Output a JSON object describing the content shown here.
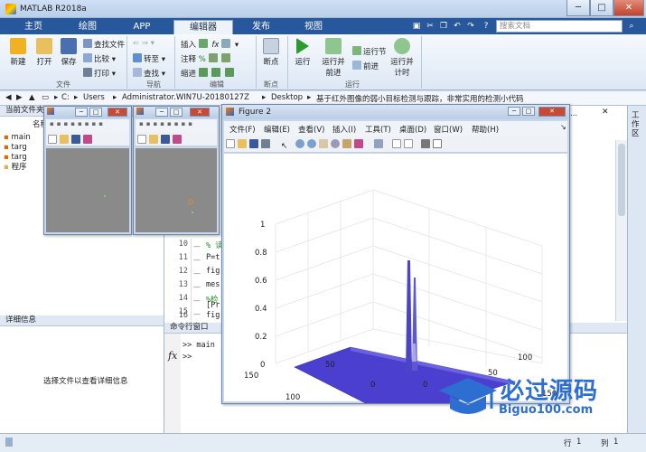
{
  "app": {
    "title": "MATLAB R2018a"
  },
  "window_controls": {
    "minimize": "─",
    "maximize": "□",
    "close": "✕"
  },
  "ribbon_tabs": [
    {
      "label": "主页"
    },
    {
      "label": "绘图"
    },
    {
      "label": "APP"
    },
    {
      "label": "编辑器"
    },
    {
      "label": "发布"
    },
    {
      "label": "视图"
    }
  ],
  "search": {
    "placeholder": "搜索文档"
  },
  "ribbon": {
    "file": {
      "new": "新建",
      "open": "打开",
      "save": "保存",
      "find_files": "查找文件",
      "compare": "比较",
      "print": "打印",
      "group": "文件"
    },
    "nav": {
      "goto": "转至",
      "find": "查找",
      "group": "导航"
    },
    "edit": {
      "insert": "插入",
      "comment": "注释",
      "indent": "缩进",
      "fx": "fx",
      "group": "编辑"
    },
    "breakpoints": {
      "label": "断点",
      "group": "断点"
    },
    "run": {
      "run": "运行",
      "run_advance_1": "运行并",
      "run_advance_2": "前进",
      "run_section": "运行节",
      "advance": "前进",
      "run_time_1": "运行并",
      "run_time_2": "计时",
      "group": "运行"
    }
  },
  "address": {
    "drive": "C:",
    "parts": [
      "Users",
      "Administrator.WIN7U-20180127Z",
      "Desktop",
      "基于红外图像的弱小目标检测与跟踪，非常实用的检测小代码"
    ]
  },
  "current_folder": {
    "title": "当前文件夹",
    "column": "名称",
    "files": [
      "main",
      "targ",
      "targ",
      "程序"
    ]
  },
  "details": {
    "title": "详细信息",
    "message": "选择文件以查看详细信息"
  },
  "editor": {
    "tab_hint": "小代...",
    "lines": [
      {
        "num": "10",
        "text": "% 读"
      },
      {
        "num": "11",
        "text": "P=t"
      },
      {
        "num": "12",
        "text": "fig"
      },
      {
        "num": "13",
        "text": "mes"
      },
      {
        "num": "14",
        "text": "%检"
      },
      {
        "num": "15",
        "text": "[Pr"
      },
      {
        "num": "16",
        "text": "fig"
      }
    ]
  },
  "command_window": {
    "title": "命令行窗口",
    "history": ">> main",
    "prompt": ">>",
    "fx": "fx"
  },
  "right_strip": {
    "label": "工作区"
  },
  "status": {
    "row_label": "行",
    "row": "1",
    "col_label": "列",
    "col": "1"
  },
  "figure2": {
    "title": "Figure 2",
    "menu": [
      "文件(F)",
      "编辑(E)",
      "查看(V)",
      "插入(I)",
      "工具(T)",
      "桌面(D)",
      "窗口(W)",
      "帮助(H)"
    ]
  },
  "chart_data": {
    "type": "surface3d",
    "description_axes": {
      "z_ticks": [
        "0",
        "0.2",
        "0.4",
        "0.6",
        "0.8",
        "1"
      ],
      "y_ticks": [
        "0",
        "50",
        "100",
        "150"
      ],
      "x_ticks": [
        "0",
        "50",
        "100",
        "150"
      ]
    },
    "zlim": [
      0,
      1
    ],
    "xlim": [
      0,
      150
    ],
    "ylim": [
      0,
      150
    ],
    "peaks": [
      {
        "x": 85,
        "y": 110,
        "z": 1.0
      },
      {
        "x": 90,
        "y": 112,
        "z": 0.82
      },
      {
        "x": 80,
        "y": 108,
        "z": 0.15
      }
    ],
    "surface_color": "#4b3fd0"
  },
  "watermark": {
    "main": "必过源码",
    "sub": "Biguo100.com"
  }
}
